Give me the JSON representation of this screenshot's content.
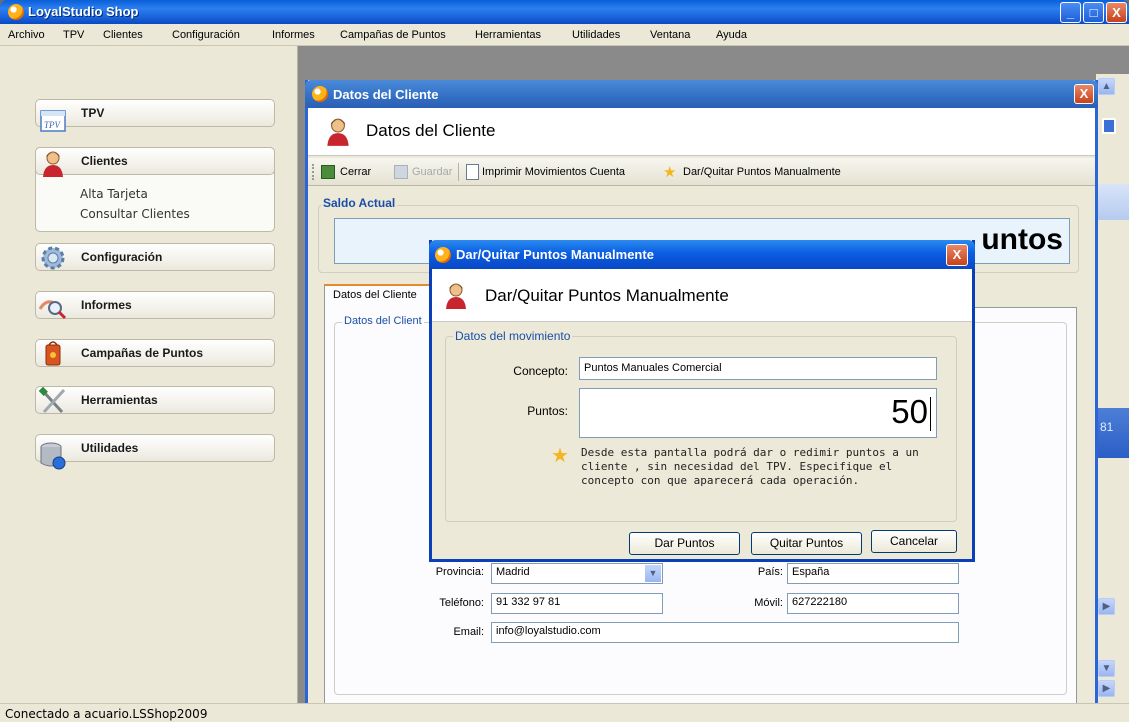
{
  "app": {
    "title": "LoyalStudio Shop",
    "minimize": "_",
    "maximize": "□",
    "close": "X"
  },
  "menu": [
    "Archivo",
    "TPV",
    "Clientes",
    "Configuración",
    "Informes",
    "Campañas de Puntos",
    "Herramientas",
    "Utilidades",
    "Ventana",
    "Ayuda"
  ],
  "sidebar": {
    "tpv": "TPV",
    "clientes": "Clientes",
    "clientes_items": [
      "Alta Tarjeta",
      "Consultar Clientes"
    ],
    "configuracion": "Configuración",
    "informes": "Informes",
    "campanas": "Campañas de Puntos",
    "herramientas": "Herramientas",
    "utilidades": "Utilidades"
  },
  "child": {
    "title": "Datos del Cliente",
    "header": "Datos del Cliente",
    "close": "X",
    "toolbar": {
      "cerrar": "Cerrar",
      "guardar": "Guardar",
      "imprimir": "Imprimir Movimientos Cuenta",
      "dar_quitar": "Dar/Quitar Puntos Manualmente"
    },
    "saldo": {
      "title": "Saldo Actual",
      "value": "50 Puntos",
      "visible_suffix": "untos"
    },
    "tab": "Datos del Cliente",
    "group_title": "Datos del Client",
    "fields": {
      "provincia_label": "Provincia:",
      "provincia": "Madrid",
      "pais_label": "País:",
      "pais": "España",
      "telefono_label": "Teléfono:",
      "telefono": "91 332 97 81",
      "movil_label": "Móvil:",
      "movil": "627222180",
      "email_label": "Email:",
      "email": "info@loyalstudio.com"
    }
  },
  "dialog": {
    "title": "Dar/Quitar Puntos Manualmente",
    "header": "Dar/Quitar Puntos Manualmente",
    "close": "X",
    "group_title": "Datos del movimiento",
    "concepto_label": "Concepto:",
    "concepto": "Puntos Manuales Comercial",
    "puntos_label": "Puntos:",
    "puntos": "50",
    "info": "Desde esta pantalla podrá dar o redimir puntos a un cliente , sin necesidad del TPV. Especifique el concepto con que aparecerá cada operación.",
    "btn_dar": "Dar Puntos",
    "btn_quitar": "Quitar Puntos",
    "btn_cancelar": "Cancelar"
  },
  "right_fragment": "81",
  "status": "Conectado a acuario.LSShop2009"
}
